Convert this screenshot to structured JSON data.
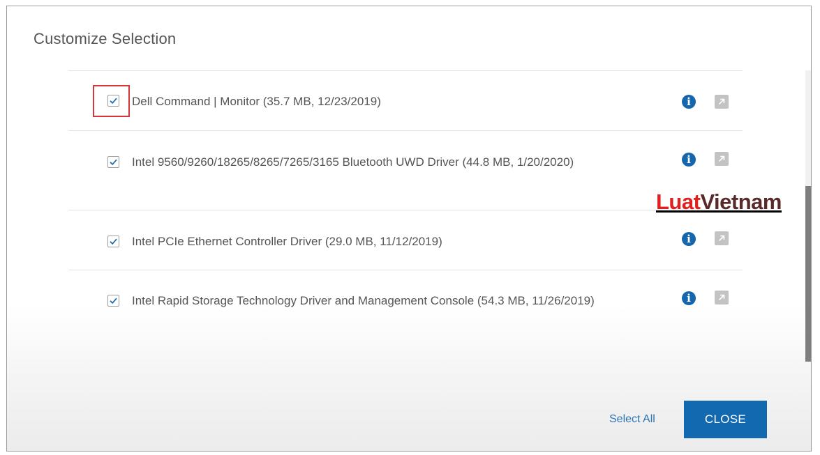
{
  "dialog": {
    "title": "Customize Selection"
  },
  "items": [
    {
      "label": "Dell Command | Monitor (35.7 MB, 12/23/2019)",
      "checked": true,
      "info_icon": "info-icon",
      "open_icon": "external-link-icon"
    },
    {
      "label": "Intel 9560/9260/18265/8265/7265/3165 Bluetooth UWD Driver (44.8 MB, 1/20/2020)",
      "checked": true,
      "info_icon": "info-icon",
      "open_icon": "external-link-icon"
    },
    {
      "label": "Intel PCIe Ethernet Controller Driver (29.0 MB, 11/12/2019)",
      "checked": true,
      "info_icon": "info-icon",
      "open_icon": "external-link-icon"
    },
    {
      "label": "Intel Rapid Storage Technology Driver and Management Console (54.3 MB, 11/26/2019)",
      "checked": true,
      "info_icon": "info-icon",
      "open_icon": "external-link-icon"
    }
  ],
  "footer": {
    "select_all_label": "Select All",
    "close_label": "CLOSE"
  },
  "watermark": {
    "part1": "Luat",
    "part2": "Vietnam"
  },
  "colors": {
    "accent": "#1269b0",
    "link": "#2c74b3",
    "checkmark": "#1f6fb2",
    "highlight_box": "#d9343a",
    "watermark_red": "#e0201f"
  }
}
